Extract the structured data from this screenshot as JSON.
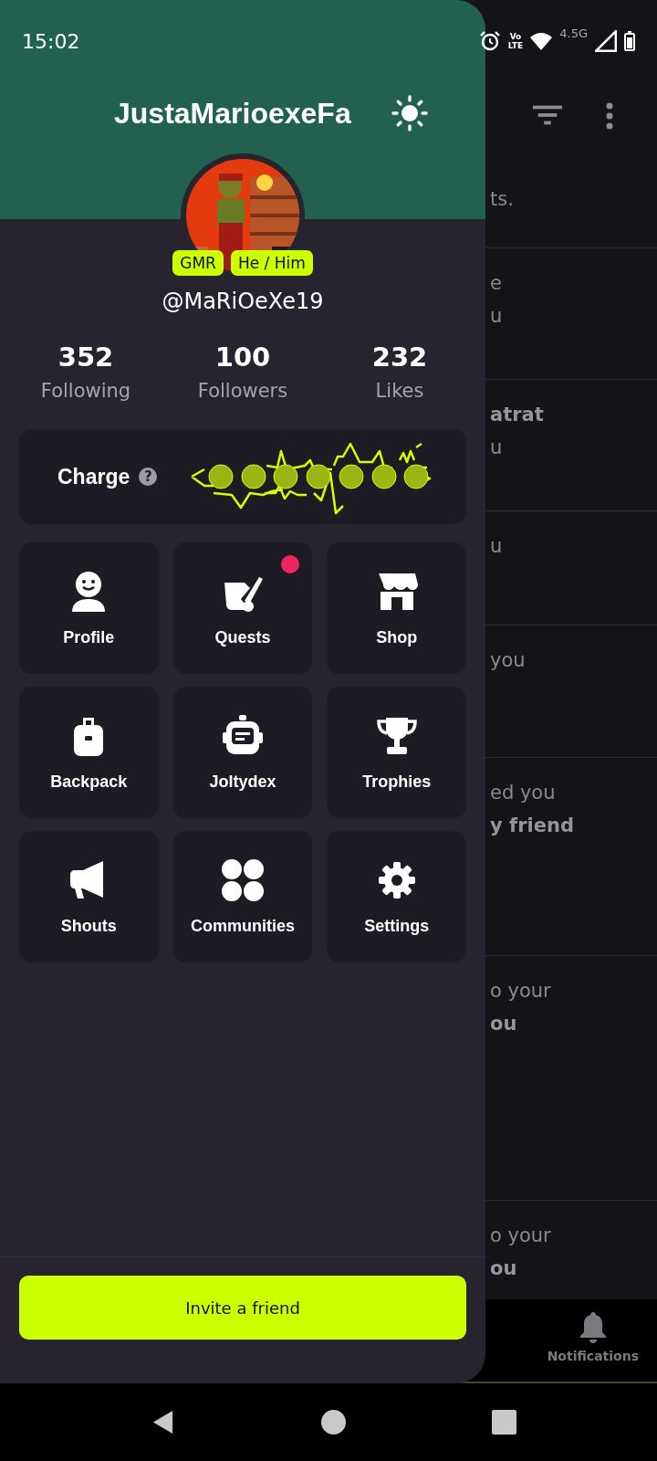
{
  "status_bar": {
    "time": "15:02",
    "volte": [
      "Vo",
      "LTE"
    ],
    "network": "4.5G"
  },
  "background": {
    "rows": [
      {
        "lines": [
          {
            "text": "ts.",
            "bold": false
          }
        ]
      },
      {
        "lines": [
          {
            "text": "e",
            "bold": false
          },
          {
            "text": "u",
            "bold": false
          }
        ]
      },
      {
        "lines": [
          {
            "text": "atrat",
            "bold": true
          },
          {
            "text": "u",
            "bold": false
          }
        ]
      },
      {
        "lines": [
          {
            "text": "u",
            "bold": false
          }
        ]
      },
      {
        "lines": [
          {
            "text": "you",
            "bold": false
          }
        ]
      },
      {
        "lines": [
          {
            "text": "ed you",
            "bold": false
          },
          {
            "text": "y friend",
            "bold": true
          }
        ]
      },
      {
        "lines": [
          {
            "text": "o your",
            "bold": false
          },
          {
            "text": "ou",
            "bold": true
          }
        ]
      },
      {
        "lines": [
          {
            "text": "o your",
            "bold": false
          },
          {
            "text": "ou",
            "bold": true
          }
        ]
      }
    ],
    "nav": {
      "label": "Notifications"
    }
  },
  "drawer": {
    "title": "JustaMarioexeFa",
    "badges": [
      "GMR",
      "He / Him"
    ],
    "handle": "@MaRiOeXe19",
    "stats": [
      {
        "value": "352",
        "label": "Following"
      },
      {
        "value": "100",
        "label": "Followers"
      },
      {
        "value": "232",
        "label": "Likes"
      }
    ],
    "charge": {
      "label": "Charge",
      "help": "?"
    },
    "menu": [
      {
        "kind": "profile",
        "label": "Profile",
        "dot": false
      },
      {
        "kind": "quests",
        "label": "Quests",
        "dot": true
      },
      {
        "kind": "shop",
        "label": "Shop",
        "dot": false
      },
      {
        "kind": "backpack",
        "label": "Backpack",
        "dot": false
      },
      {
        "kind": "joltydex",
        "label": "Joltydex",
        "dot": false
      },
      {
        "kind": "trophies",
        "label": "Trophies",
        "dot": false
      },
      {
        "kind": "shouts",
        "label": "Shouts",
        "dot": false
      },
      {
        "kind": "communities",
        "label": "Communities",
        "dot": false
      },
      {
        "kind": "settings",
        "label": "Settings",
        "dot": false
      }
    ],
    "invite": "Invite a friend"
  }
}
